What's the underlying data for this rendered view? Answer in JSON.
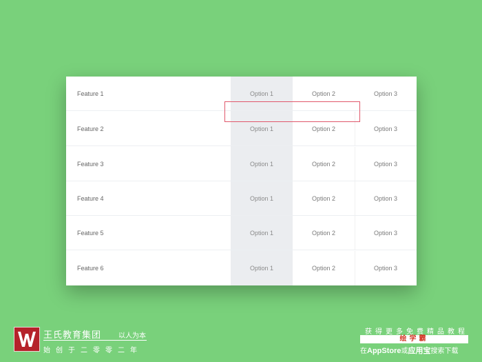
{
  "table": {
    "rows": [
      {
        "feature": "Feature 1",
        "option1": "Option 1",
        "option2": "Option 2",
        "option3": "Option 3"
      },
      {
        "feature": "Feature 2",
        "option1": "Option 1",
        "option2": "Option 2",
        "option3": "Option 3"
      },
      {
        "feature": "Feature 3",
        "option1": "Option 1",
        "option2": "Option 2",
        "option3": "Option 3"
      },
      {
        "feature": "Feature 4",
        "option1": "Option 1",
        "option2": "Option 2",
        "option3": "Option 3"
      },
      {
        "feature": "Feature 5",
        "option1": "Option 1",
        "option2": "Option 2",
        "option3": "Option 3"
      },
      {
        "feature": "Feature 6",
        "option1": "Option 1",
        "option2": "Option 2",
        "option3": "Option 3"
      }
    ]
  },
  "brand": {
    "name": "王氏教育集团",
    "slogan": "以人为本",
    "sub": "始创于二零零二年"
  },
  "promo": {
    "line1": "获得更多免费精品教程",
    "app_name": "绘学霸",
    "line3_prefix": "在",
    "line3_store": "AppStore",
    "line3_mid": "或",
    "line3_app": "应用宝",
    "line3_suffix": "搜索下载"
  },
  "colors": {
    "background": "#79d17b",
    "highlight_column": "#ebedf0",
    "selection_border": "#e0566a",
    "brand_red": "#b5222a"
  }
}
